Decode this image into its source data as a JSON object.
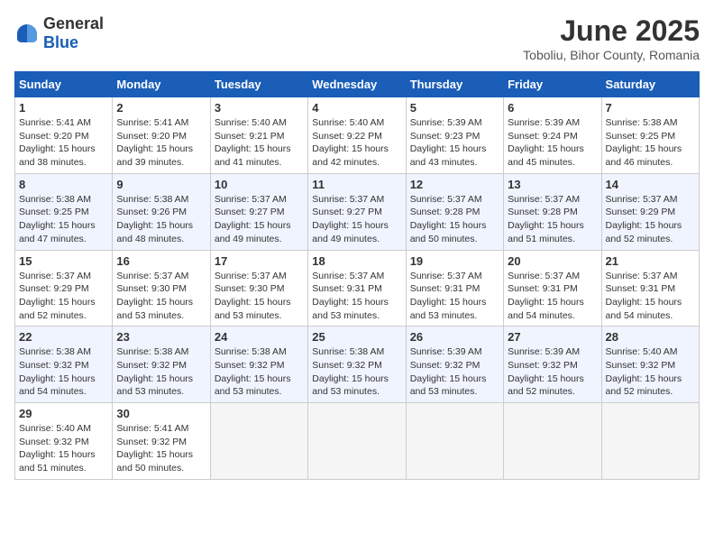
{
  "header": {
    "logo": {
      "general": "General",
      "blue": "Blue"
    },
    "title": "June 2025",
    "location": "Toboliu, Bihor County, Romania"
  },
  "calendar": {
    "weekdays": [
      "Sunday",
      "Monday",
      "Tuesday",
      "Wednesday",
      "Thursday",
      "Friday",
      "Saturday"
    ],
    "weeks": [
      [
        {
          "day": "1",
          "sunrise": "5:41 AM",
          "sunset": "9:20 PM",
          "daylight": "15 hours and 38 minutes."
        },
        {
          "day": "2",
          "sunrise": "5:41 AM",
          "sunset": "9:20 PM",
          "daylight": "15 hours and 39 minutes."
        },
        {
          "day": "3",
          "sunrise": "5:40 AM",
          "sunset": "9:21 PM",
          "daylight": "15 hours and 41 minutes."
        },
        {
          "day": "4",
          "sunrise": "5:40 AM",
          "sunset": "9:22 PM",
          "daylight": "15 hours and 42 minutes."
        },
        {
          "day": "5",
          "sunrise": "5:39 AM",
          "sunset": "9:23 PM",
          "daylight": "15 hours and 43 minutes."
        },
        {
          "day": "6",
          "sunrise": "5:39 AM",
          "sunset": "9:24 PM",
          "daylight": "15 hours and 45 minutes."
        },
        {
          "day": "7",
          "sunrise": "5:38 AM",
          "sunset": "9:25 PM",
          "daylight": "15 hours and 46 minutes."
        }
      ],
      [
        {
          "day": "8",
          "sunrise": "5:38 AM",
          "sunset": "9:25 PM",
          "daylight": "15 hours and 47 minutes."
        },
        {
          "day": "9",
          "sunrise": "5:38 AM",
          "sunset": "9:26 PM",
          "daylight": "15 hours and 48 minutes."
        },
        {
          "day": "10",
          "sunrise": "5:37 AM",
          "sunset": "9:27 PM",
          "daylight": "15 hours and 49 minutes."
        },
        {
          "day": "11",
          "sunrise": "5:37 AM",
          "sunset": "9:27 PM",
          "daylight": "15 hours and 49 minutes."
        },
        {
          "day": "12",
          "sunrise": "5:37 AM",
          "sunset": "9:28 PM",
          "daylight": "15 hours and 50 minutes."
        },
        {
          "day": "13",
          "sunrise": "5:37 AM",
          "sunset": "9:28 PM",
          "daylight": "15 hours and 51 minutes."
        },
        {
          "day": "14",
          "sunrise": "5:37 AM",
          "sunset": "9:29 PM",
          "daylight": "15 hours and 52 minutes."
        }
      ],
      [
        {
          "day": "15",
          "sunrise": "5:37 AM",
          "sunset": "9:29 PM",
          "daylight": "15 hours and 52 minutes."
        },
        {
          "day": "16",
          "sunrise": "5:37 AM",
          "sunset": "9:30 PM",
          "daylight": "15 hours and 53 minutes."
        },
        {
          "day": "17",
          "sunrise": "5:37 AM",
          "sunset": "9:30 PM",
          "daylight": "15 hours and 53 minutes."
        },
        {
          "day": "18",
          "sunrise": "5:37 AM",
          "sunset": "9:31 PM",
          "daylight": "15 hours and 53 minutes."
        },
        {
          "day": "19",
          "sunrise": "5:37 AM",
          "sunset": "9:31 PM",
          "daylight": "15 hours and 53 minutes."
        },
        {
          "day": "20",
          "sunrise": "5:37 AM",
          "sunset": "9:31 PM",
          "daylight": "15 hours and 54 minutes."
        },
        {
          "day": "21",
          "sunrise": "5:37 AM",
          "sunset": "9:31 PM",
          "daylight": "15 hours and 54 minutes."
        }
      ],
      [
        {
          "day": "22",
          "sunrise": "5:38 AM",
          "sunset": "9:32 PM",
          "daylight": "15 hours and 54 minutes."
        },
        {
          "day": "23",
          "sunrise": "5:38 AM",
          "sunset": "9:32 PM",
          "daylight": "15 hours and 53 minutes."
        },
        {
          "day": "24",
          "sunrise": "5:38 AM",
          "sunset": "9:32 PM",
          "daylight": "15 hours and 53 minutes."
        },
        {
          "day": "25",
          "sunrise": "5:38 AM",
          "sunset": "9:32 PM",
          "daylight": "15 hours and 53 minutes."
        },
        {
          "day": "26",
          "sunrise": "5:39 AM",
          "sunset": "9:32 PM",
          "daylight": "15 hours and 53 minutes."
        },
        {
          "day": "27",
          "sunrise": "5:39 AM",
          "sunset": "9:32 PM",
          "daylight": "15 hours and 52 minutes."
        },
        {
          "day": "28",
          "sunrise": "5:40 AM",
          "sunset": "9:32 PM",
          "daylight": "15 hours and 52 minutes."
        }
      ],
      [
        {
          "day": "29",
          "sunrise": "5:40 AM",
          "sunset": "9:32 PM",
          "daylight": "15 hours and 51 minutes."
        },
        {
          "day": "30",
          "sunrise": "5:41 AM",
          "sunset": "9:32 PM",
          "daylight": "15 hours and 50 minutes."
        },
        null,
        null,
        null,
        null,
        null
      ]
    ]
  }
}
